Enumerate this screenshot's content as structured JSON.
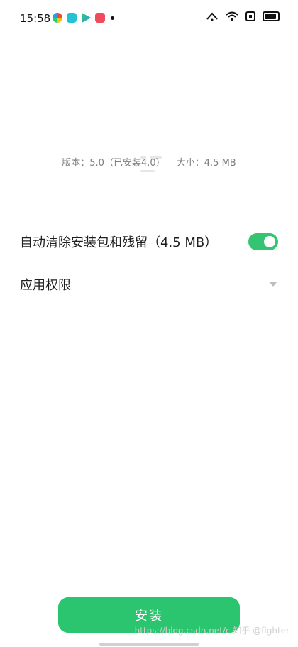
{
  "status_bar": {
    "time": "15:58",
    "app_icons": [
      "camera-icon",
      "message-icon",
      "play-icon",
      "app-icon"
    ],
    "system_icons": [
      "notification-icon",
      "wifi-icon",
      "sim-icon",
      "battery-icon"
    ]
  },
  "app_info": {
    "version_text": "版本：5.0（已安装4.0）",
    "size_text": "大小：4.5 MB"
  },
  "options": {
    "auto_clean_label": "自动清除安装包和残留（4.5 MB）",
    "auto_clean_enabled": true,
    "permissions_label": "应用权限"
  },
  "install_button": {
    "label": "安装"
  },
  "watermark": "https://blog.csdn.net/c 知乎 @fighter",
  "colors": {
    "accent": "#2cc56f",
    "toggle_on": "#34c472"
  }
}
